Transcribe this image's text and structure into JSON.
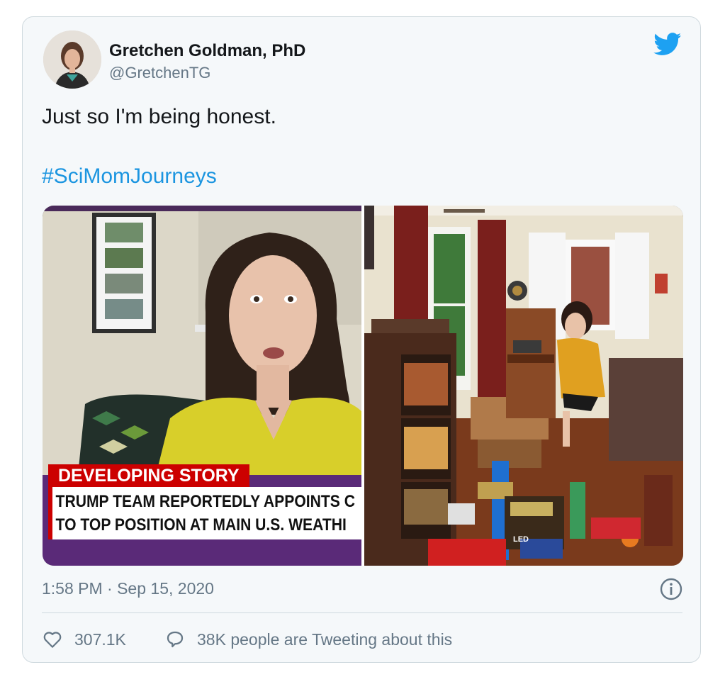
{
  "tweet": {
    "author_name": "Gretchen Goldman, PhD",
    "author_handle": "@GretchenTG",
    "text": "Just so I'm being honest.",
    "hashtag": "#SciMomJourneys",
    "timestamp": "1:58 PM · Sep 15, 2020",
    "likes": "307.1K",
    "replies_text": "38K people are Tweeting about this"
  },
  "media": {
    "left": {
      "banner_title": "DEVELOPING STORY",
      "banner_line1": "TRUMP TEAM REPORTEDLY APPOINTS C",
      "banner_line2": "TO TOP POSITION AT MAIN U.S. WEATHI"
    },
    "right": {
      "box_label": "LED"
    }
  },
  "icons": {
    "brand": "twitter-bird-icon",
    "info": "info-icon",
    "like": "heart-icon",
    "reply": "speech-bubble-icon"
  },
  "colors": {
    "brand": "#1da1f2",
    "hashtag": "#1b95e0",
    "muted": "#657786",
    "cnn_red": "#cc0000",
    "card_bg": "#f5f8fa"
  }
}
